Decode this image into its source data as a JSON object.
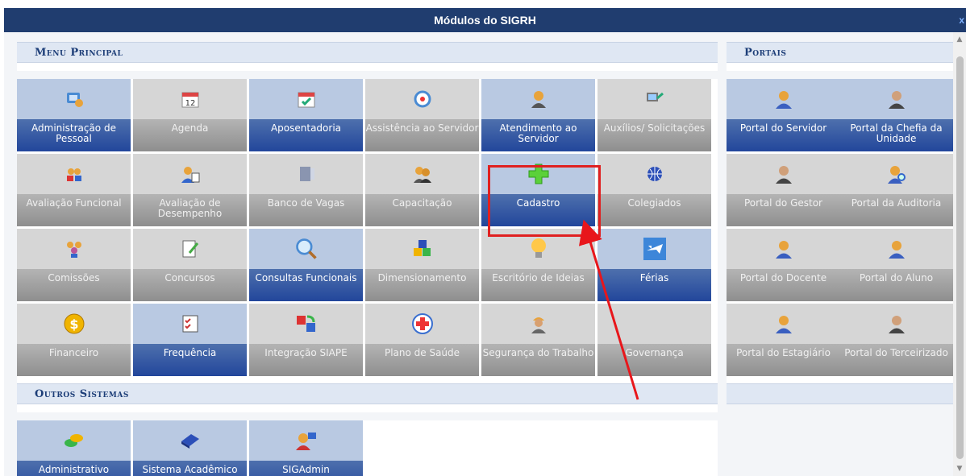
{
  "window": {
    "title": "Módulos do SIGRH",
    "close_glyph": "x"
  },
  "menu_principal": {
    "title": "Menu Principal",
    "tiles": [
      {
        "label": "Administração de Pessoal",
        "icon": "admin-icon",
        "enabled": true
      },
      {
        "label": "Agenda",
        "icon": "calendar-icon",
        "enabled": false
      },
      {
        "label": "Aposentadoria",
        "icon": "calendar-check-icon",
        "enabled": true
      },
      {
        "label": "Assistência ao Servidor",
        "icon": "lifebuoy-icon",
        "enabled": false
      },
      {
        "label": "Atendimento ao Servidor",
        "icon": "headset-user-icon",
        "enabled": true
      },
      {
        "label": "Auxílios/ Solicitações",
        "icon": "computer-request-icon",
        "enabled": false
      },
      {
        "label": "Avaliação Funcional",
        "icon": "users-icon",
        "enabled": false
      },
      {
        "label": "Avaliação de Desempenho",
        "icon": "user-evaluation-icon",
        "enabled": false
      },
      {
        "label": "Banco de Vagas",
        "icon": "database-icon",
        "enabled": false
      },
      {
        "label": "Capacitação",
        "icon": "people-group-icon",
        "enabled": false
      },
      {
        "label": "Cadastro",
        "icon": "plus-icon",
        "enabled": true
      },
      {
        "label": "Colegiados",
        "icon": "globe-icon",
        "enabled": false
      },
      {
        "label": "Comissões",
        "icon": "team-icon",
        "enabled": false
      },
      {
        "label": "Concursos",
        "icon": "document-edit-icon",
        "enabled": false
      },
      {
        "label": "Consultas Funcionais",
        "icon": "magnifier-icon",
        "enabled": true
      },
      {
        "label": "Dimensionamento",
        "icon": "cubes-icon",
        "enabled": false
      },
      {
        "label": "Escritório de Ideias",
        "icon": "lightbulb-icon",
        "enabled": false
      },
      {
        "label": "Férias",
        "icon": "airplane-icon",
        "enabled": true
      },
      {
        "label": "Financeiro",
        "icon": "dollar-coin-icon",
        "enabled": false
      },
      {
        "label": "Frequência",
        "icon": "checklist-icon",
        "enabled": true
      },
      {
        "label": "Integração SIAPE",
        "icon": "sync-icon",
        "enabled": false
      },
      {
        "label": "Plano de Saúde",
        "icon": "health-cross-icon",
        "enabled": false
      },
      {
        "label": "Segurança do Trabalho",
        "icon": "worker-icon",
        "enabled": false
      },
      {
        "label": "Governança",
        "icon": "",
        "enabled": false
      }
    ]
  },
  "portais": {
    "title": "Portais",
    "tiles": [
      {
        "label": "Portal do Servidor",
        "icon": "user-blue-icon",
        "enabled": true
      },
      {
        "label": "Portal da Chefia da Unidade",
        "icon": "user-dark-icon",
        "enabled": true
      },
      {
        "label": "Portal do Gestor",
        "icon": "user-dark-icon",
        "enabled": false
      },
      {
        "label": "Portal da Auditoria",
        "icon": "user-search-icon",
        "enabled": false
      },
      {
        "label": "Portal do Docente",
        "icon": "user-blue-icon",
        "enabled": false
      },
      {
        "label": "Portal do Aluno",
        "icon": "user-blue-icon",
        "enabled": false
      },
      {
        "label": "Portal do Estagiário",
        "icon": "user-blue-icon",
        "enabled": false
      },
      {
        "label": "Portal do Terceirizado",
        "icon": "user-dark-icon",
        "enabled": false
      }
    ]
  },
  "outros_sistemas": {
    "title": "Outros Sistemas",
    "tiles": [
      {
        "label": "Administrativo",
        "icon": "coins-icon",
        "enabled": true
      },
      {
        "label": "Sistema Acadêmico",
        "icon": "book-icon",
        "enabled": true
      },
      {
        "label": "SIGAdmin",
        "icon": "admin-user-icon",
        "enabled": true
      }
    ]
  },
  "colors": {
    "titlebar": "#203d6f",
    "tile_on": "#22469b",
    "tile_off": "#8e8e8e",
    "highlight": "#e02020"
  }
}
